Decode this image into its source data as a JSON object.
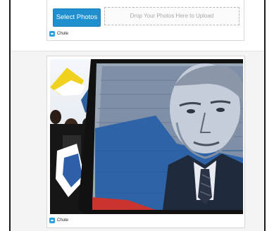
{
  "upload": {
    "select_label": "Select Photos",
    "drop_label": "Drop Your Photos Here to Upload"
  },
  "brand": {
    "name": "Chute",
    "icon": "chute-logo-icon",
    "color": "#2d9ee0"
  },
  "photo_card": {
    "brand_name": "Chute"
  },
  "colors": {
    "button_blue": "#1f8fd0",
    "page_band": "#f4f4f4"
  }
}
